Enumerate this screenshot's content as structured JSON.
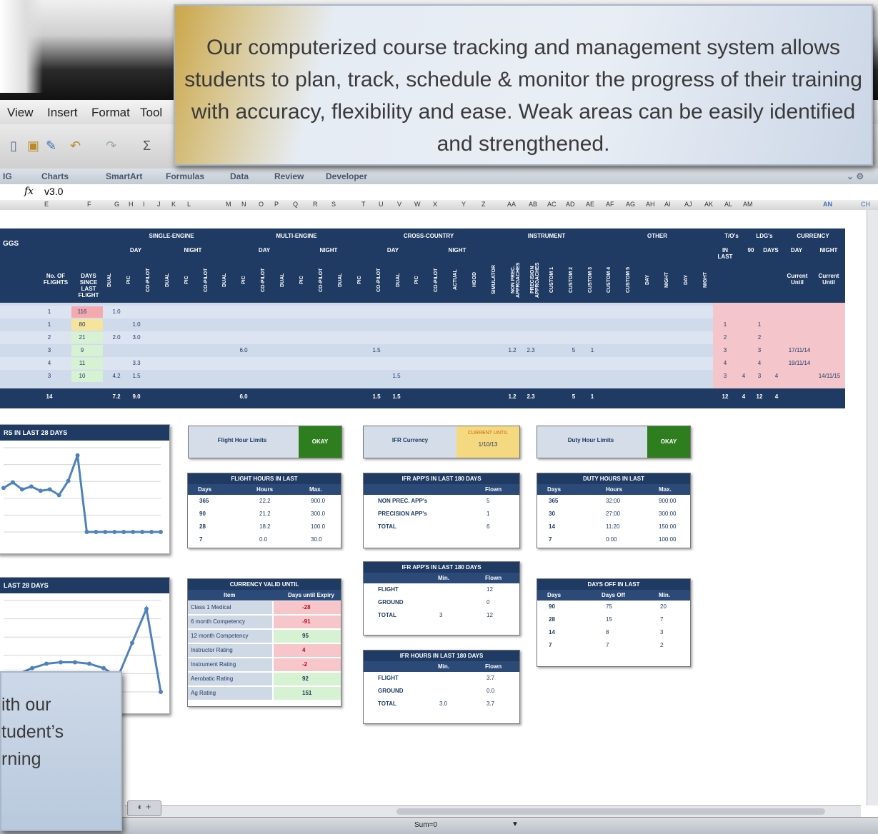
{
  "menu": {
    "items": [
      "View",
      "Insert",
      "Format",
      "Tool"
    ]
  },
  "ribbon": {
    "tabs": [
      "Charts",
      "SmartArt",
      "Formulas",
      "Data",
      "Review",
      "Developer"
    ],
    "left_fragment": "IG"
  },
  "formula_bar": {
    "fx": "fx",
    "value": "v3.0"
  },
  "columns": [
    "E",
    "F",
    "G",
    "H",
    "I",
    "J",
    "K",
    "L",
    "M",
    "N",
    "O",
    "P",
    "Q",
    "R",
    "S",
    "T",
    "U",
    "V",
    "W",
    "X",
    "Y",
    "Z",
    "AA",
    "AB",
    "AC",
    "AD",
    "AE",
    "AF",
    "AG",
    "AH",
    "AI",
    "AJ",
    "AK",
    "AL",
    "AM",
    "AN",
    "CH"
  ],
  "callout_top": {
    "text": "Our computerized course tracking and management system allows students to plan, track, schedule & monitor the progress of their training with accuracy, flexibility and ease. Weak areas can be easily identified and strengthened."
  },
  "callout_bottom": {
    "text": "ith our\ntudent’s\nrning"
  },
  "main_table": {
    "title": "GGS",
    "groups": [
      "SINGLE-ENGINE",
      "MULTI-ENGINE",
      "CROSS-COUNTRY",
      "INSTRUMENT",
      "OTHER",
      "T/O's",
      "LDG's",
      "CURRENCY"
    ],
    "subgroups": [
      "DAY",
      "NIGHT",
      "DAY",
      "NIGHT",
      "DAY",
      "NIGHT",
      "IN LAST",
      "90",
      "DAYS",
      "DAY",
      "NIGHT"
    ],
    "col_headers": [
      "No. OF FLIGHTS",
      "DAYS SINCE LAST FLIGHT"
    ],
    "vertical_headers": [
      "DUAL",
      "PIC",
      "CO-PILOT",
      "DUAL",
      "PIC",
      "CO-PILOT",
      "DUAL",
      "PIC",
      "CO-PILOT",
      "DUAL",
      "PIC",
      "CO-PILOT",
      "DUAL",
      "PIC",
      "CO-PILOT",
      "DUAL",
      "PIC",
      "CO-PILOT",
      "ACTUAL",
      "HOOD",
      "SIMULATOR",
      "NON PREC. APPROACHES",
      "PRECISION APPROACHES",
      "CUSTOM 1",
      "CUSTOM 2",
      "CUSTOM 3",
      "CUSTOM 4",
      "CUSTOM 5",
      "DAY",
      "NIGHT",
      "DAY",
      "NIGHT"
    ],
    "currency_headers": [
      "Current Until",
      "Current Until"
    ],
    "rows": [
      {
        "flights": "1",
        "days": "116",
        "g": "1.0",
        "h": "",
        "m": "",
        "s": "",
        "t": "",
        "y": "",
        "z": "",
        "ab": "",
        "ac": "",
        "ai": "",
        "aj": "",
        "ak": "",
        "al": "",
        "am": "",
        "an": ""
      },
      {
        "flights": "1",
        "days": "80",
        "g": "",
        "h": "1.0",
        "m": "",
        "s": "",
        "t": "",
        "y": "",
        "z": "",
        "ab": "",
        "ac": "",
        "ai": "1",
        "aj": "",
        "ak": "1",
        "al": "",
        "am": "",
        "an": ""
      },
      {
        "flights": "2",
        "days": "21",
        "g": "2.0",
        "h": "3.0",
        "m": "",
        "s": "",
        "t": "",
        "y": "",
        "z": "",
        "ab": "",
        "ac": "",
        "ai": "2",
        "aj": "",
        "ak": "2",
        "al": "",
        "am": "",
        "an": ""
      },
      {
        "flights": "3",
        "days": "9",
        "g": "",
        "h": "",
        "m": "6.0",
        "s": "1.5",
        "t": "",
        "y": "1.2",
        "z": "2.3",
        "ab": "5",
        "ac": "1",
        "ai": "3",
        "aj": "",
        "ak": "3",
        "al": "",
        "am": "17/11/14",
        "an": ""
      },
      {
        "flights": "4",
        "days": "11",
        "g": "",
        "h": "3.3",
        "m": "",
        "s": "",
        "t": "",
        "y": "",
        "z": "",
        "ab": "",
        "ac": "",
        "ai": "4",
        "aj": "",
        "ak": "4",
        "al": "",
        "am": "19/11/14",
        "an": ""
      },
      {
        "flights": "3",
        "days": "10",
        "g": "4.2",
        "h": "1.5",
        "m": "",
        "s": "",
        "t": "1.5",
        "y": "",
        "z": "",
        "ab": "",
        "ac": "",
        "ai": "3",
        "aj": "4",
        "ak": "3",
        "al": "4",
        "am": "",
        "an": "14/11/15"
      }
    ],
    "totals": {
      "flights": "14",
      "g": "7.2",
      "h": "9.0",
      "m": "6.0",
      "s": "1.5",
      "t": "1.5",
      "y": "1.2",
      "z": "2.3",
      "ab": "5",
      "ac": "1",
      "ai": "12",
      "aj": "4",
      "ak": "12",
      "al": "4"
    }
  },
  "charts": [
    {
      "title": "RS IN LAST 28 DAYS",
      "values": [
        3.1,
        3.5,
        3.0,
        3.2,
        2.9,
        3.0,
        2.6,
        3.6,
        5.4,
        0,
        0,
        0,
        0,
        0,
        0,
        0,
        0,
        0
      ]
    },
    {
      "title": "LAST 28 DAYS",
      "values": [
        0.8,
        1.2,
        1.6,
        1.9,
        2.0,
        2.0,
        1.9,
        1.6,
        1.0,
        3.3,
        5.6,
        0.0
      ]
    }
  ],
  "status_boxes": [
    {
      "label": "Flight Hour Limits",
      "status": "OKAY",
      "color": "#2e7d1f"
    },
    {
      "label": "IFR Currency",
      "status": "CURRENT UNTIL",
      "value": "1/10/13",
      "color": "#f5d981"
    },
    {
      "label": "Duty Hour Limits",
      "status": "OKAY",
      "color": "#2e7d1f"
    }
  ],
  "flight_hours": {
    "title": "FLIGHT HOURS IN LAST",
    "headers": [
      "Days",
      "Hours",
      "Max."
    ],
    "rows": [
      [
        "365",
        "22.2",
        "900.0"
      ],
      [
        "90",
        "21.2",
        "300.0"
      ],
      [
        "28",
        "18.2",
        "100.0"
      ],
      [
        "7",
        "0.0",
        "30.0"
      ]
    ]
  },
  "ifr_apps": {
    "title": "IFR APP'S IN LAST   180   DAYS",
    "header": "Flown",
    "rows": [
      [
        "NON PREC. APP's",
        "5"
      ],
      [
        "PRECISION APP's",
        "1"
      ],
      [
        "TOTAL",
        "6"
      ]
    ]
  },
  "duty_hours": {
    "title": "DUTY HOURS IN LAST",
    "headers": [
      "Days",
      "Hours",
      "Max."
    ],
    "rows": [
      [
        "365",
        "32:00",
        "900:00"
      ],
      [
        "30",
        "27:00",
        "300:00"
      ],
      [
        "14",
        "11:20",
        "150:00"
      ],
      [
        "7",
        "0:00",
        "100:00"
      ]
    ]
  },
  "currency": {
    "title": "CURRENCY VALID UNTIL",
    "headers": [
      "Item",
      "Days until Expiry"
    ],
    "rows": [
      {
        "item": "Class 1 Medical",
        "days": "-28",
        "state": "pk"
      },
      {
        "item": "6 month Competency",
        "days": "-91",
        "state": "pk"
      },
      {
        "item": "12 month Competency",
        "days": "95",
        "state": "g"
      },
      {
        "item": "Instructor Rating",
        "days": "4",
        "state": "pk"
      },
      {
        "item": "Instrument Rating",
        "days": "-2",
        "state": "pk"
      },
      {
        "item": "Aerobatic Rating",
        "days": "92",
        "state": "g"
      },
      {
        "item": "Ag Rating",
        "days": "151",
        "state": "g"
      }
    ]
  },
  "ifr_apps2": {
    "title": "IFR APP'S IN LAST   180   DAYS",
    "headers": [
      "Min.",
      "Flown"
    ],
    "rows": [
      [
        "FLIGHT",
        "",
        "12"
      ],
      [
        "GROUND",
        "",
        "0"
      ],
      [
        "TOTAL",
        "3",
        "12"
      ]
    ]
  },
  "ifr_hours": {
    "title": "IFR HOURS IN LAST   180   DAYS",
    "headers": [
      "Min.",
      "Flown"
    ],
    "rows": [
      [
        "FLIGHT",
        "",
        "3.7"
      ],
      [
        "GROUND",
        "",
        "0.0"
      ],
      [
        "TOTAL",
        "3.0",
        "3.7"
      ]
    ]
  },
  "days_off": {
    "title": "DAYS OFF IN LAST",
    "headers": [
      "Days",
      "Days Off",
      "Min."
    ],
    "rows": [
      [
        "90",
        "75",
        "20"
      ],
      [
        "28",
        "15",
        "7"
      ],
      [
        "14",
        "8",
        "3"
      ],
      [
        "7",
        "7",
        "2"
      ]
    ]
  },
  "statusbar": {
    "sum": "Sum=0"
  }
}
